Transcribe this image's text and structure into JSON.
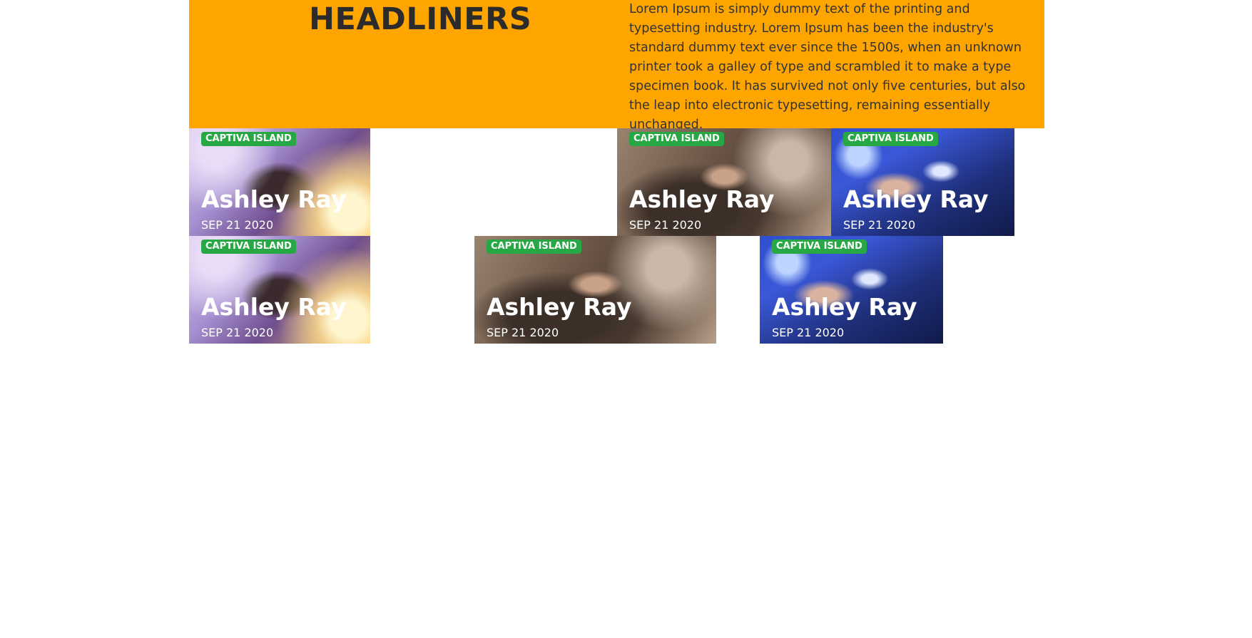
{
  "hero": {
    "title": "HEADLINERS",
    "description": "Lorem Ipsum is simply dummy text of the printing and typesetting industry. Lorem Ipsum has been the industry's standard dummy text ever since the 1500s, when an unknown printer took a galley of type and scrambled it to make a type specimen book. It has survived not only five centuries, but also the leap into electronic typesetting, remaining essentially unchanged.",
    "background_color": "#ffa500"
  },
  "cards": [
    {
      "badge": "CAPTIVA ISLAND",
      "name": "Ashley Ray",
      "date": "SEP 21 2020"
    },
    {
      "badge": "CAPTIVA ISLAND",
      "name": "Ashley Ray",
      "date": "SEP 21 2020"
    },
    {
      "badge": "CAPTIVA ISLAND",
      "name": "Ashley Ray",
      "date": "SEP 21 2020"
    },
    {
      "badge": "CAPTIVA ISLAND",
      "name": "Ashley Ray",
      "date": "SEP 21 2020"
    },
    {
      "badge": "CAPTIVA ISLAND",
      "name": "Ashley Ray",
      "date": "SEP 21 2020"
    },
    {
      "badge": "CAPTIVA ISLAND",
      "name": "Ashley Ray",
      "date": "SEP 21 2020"
    }
  ],
  "colors": {
    "badge": "#28a745",
    "accent": "#ffa500"
  }
}
